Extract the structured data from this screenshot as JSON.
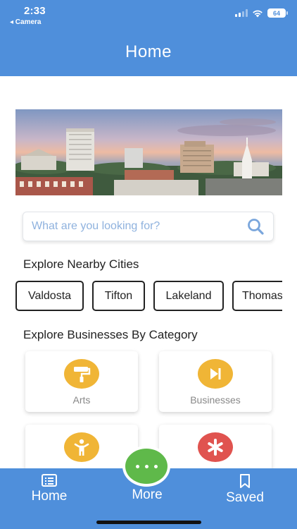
{
  "status_bar": {
    "time": "2:33",
    "back_app": "◂ Camera",
    "battery": "64"
  },
  "header": {
    "title": "Home"
  },
  "search": {
    "placeholder": "What are you looking for?"
  },
  "nearby": {
    "title": "Explore Nearby Cities",
    "cities": [
      "Valdosta",
      "Tifton",
      "Lakeland",
      "Thomasville"
    ]
  },
  "categories": {
    "title": "Explore Businesses By Category",
    "items": [
      {
        "label": "Arts",
        "icon": "paint-roller-icon",
        "color": "#f0b536"
      },
      {
        "label": "Businesses",
        "icon": "play-skip-icon",
        "color": "#f0b536"
      },
      {
        "label": "",
        "icon": "person-icon",
        "color": "#f0b536"
      },
      {
        "label": "",
        "icon": "asterisk-icon",
        "color": "#e0534f"
      }
    ]
  },
  "nav": {
    "home": "Home",
    "more": "More",
    "saved": "Saved",
    "accent": "#4f8fdb",
    "fab_color": "#5fb94a"
  }
}
